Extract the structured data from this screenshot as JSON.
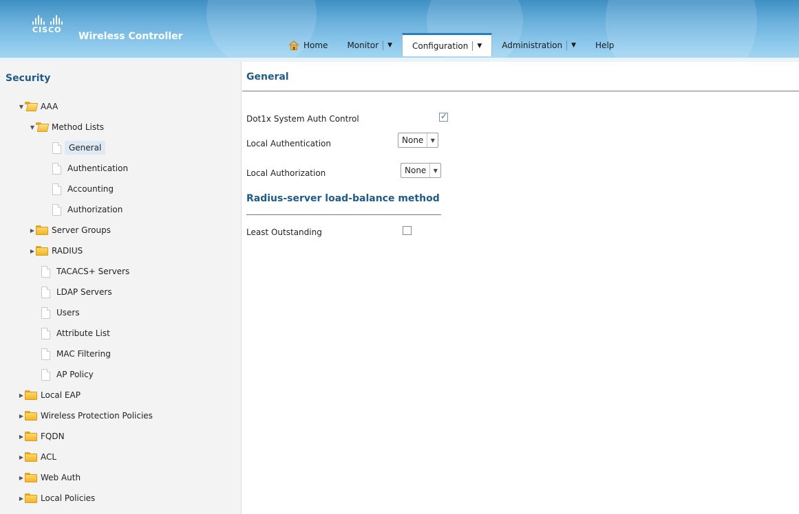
{
  "header": {
    "brand_word": "CISCO",
    "app_title": "Wireless Controller",
    "nav": [
      {
        "label": "Home",
        "icon": "home-icon",
        "has_menu": false,
        "active": false
      },
      {
        "label": "Monitor",
        "has_menu": true,
        "active": false
      },
      {
        "label": "Configuration",
        "has_menu": true,
        "active": true
      },
      {
        "label": "Administration",
        "has_menu": true,
        "active": false
      },
      {
        "label": "Help",
        "has_menu": false,
        "active": false
      }
    ],
    "dropdown_glyph": "▼"
  },
  "sidebar": {
    "title": "Security",
    "items": [
      {
        "label": "AAA",
        "type": "folder",
        "expanded": true
      },
      {
        "label": "Method Lists",
        "type": "folder",
        "expanded": true
      },
      {
        "label": "General",
        "type": "page",
        "selected": true
      },
      {
        "label": "Authentication",
        "type": "page"
      },
      {
        "label": "Accounting",
        "type": "page"
      },
      {
        "label": "Authorization",
        "type": "page"
      },
      {
        "label": "Server Groups",
        "type": "folder",
        "expanded": false
      },
      {
        "label": "RADIUS",
        "type": "folder",
        "expanded": false
      },
      {
        "label": "TACACS+ Servers",
        "type": "page"
      },
      {
        "label": "LDAP Servers",
        "type": "page"
      },
      {
        "label": "Users",
        "type": "page"
      },
      {
        "label": "Attribute List",
        "type": "page"
      },
      {
        "label": "MAC Filtering",
        "type": "page"
      },
      {
        "label": "AP Policy",
        "type": "page"
      },
      {
        "label": "Local EAP",
        "type": "folder",
        "expanded": false
      },
      {
        "label": "Wireless Protection Policies",
        "type": "folder",
        "expanded": false
      },
      {
        "label": "FQDN",
        "type": "folder",
        "expanded": false
      },
      {
        "label": "ACL",
        "type": "folder",
        "expanded": false
      },
      {
        "label": "Web Auth",
        "type": "folder",
        "expanded": false
      },
      {
        "label": "Local Policies",
        "type": "folder",
        "expanded": false
      }
    ]
  },
  "main": {
    "title": "General",
    "dot1x_label": "Dot1x System Auth Control",
    "dot1x_checked": true,
    "local_authentication_label": "Local Authentication",
    "local_authentication_value": "None",
    "local_authorization_label": "Local Authorization",
    "local_authorization_value": "None",
    "radius_section_title": "Radius-server load-balance method",
    "least_outstanding_label": "Least Outstanding",
    "least_outstanding_checked": false
  },
  "colors": {
    "header_gradient_top": "#3e8fc4",
    "header_gradient_bottom": "#a8d8f2",
    "section_title": "#1f5b8a",
    "sidebar_bg": "#f3f3f3",
    "active_tab_border": "#2a7dbb"
  }
}
